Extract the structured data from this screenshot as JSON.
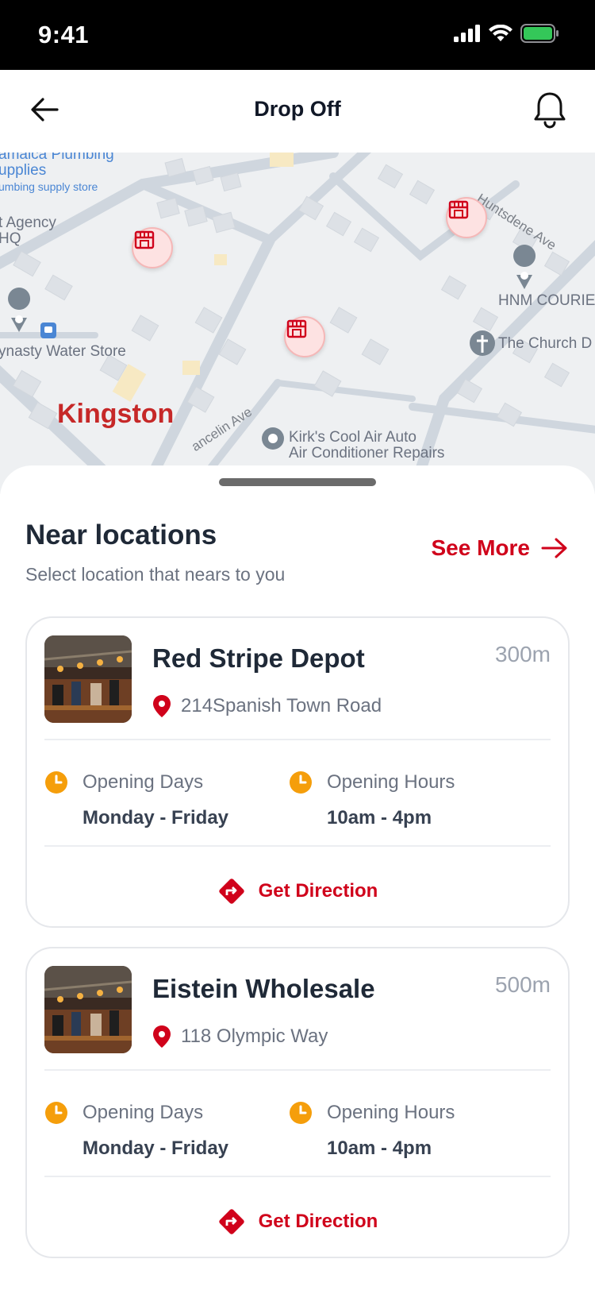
{
  "status_bar": {
    "time": "9:41"
  },
  "header": {
    "title": "Drop Off"
  },
  "map": {
    "labels": {
      "plumbing_1": "amaica Plumbing",
      "plumbing_2": "upplies",
      "plumbing_3": "umbing supply store",
      "agency_1": "t Agency",
      "agency_2": "HQ",
      "water_store": "ynasty Water Store",
      "city": "Kingston",
      "street_1": "Huntsdene Ave",
      "street_2": "ancelin Ave",
      "courier": "HNM COURIE",
      "church": "The Church D",
      "auto": "Kirk's Cool Air Auto",
      "auto_2": "Air Conditioner Repairs"
    }
  },
  "sheet": {
    "title": "Near locations",
    "subtitle": "Select location that nears to you",
    "see_more": "See More"
  },
  "locations": [
    {
      "name": "Red Stripe Depot",
      "distance": "300m",
      "address": "214Spanish Town Road",
      "days_label": "Opening Days",
      "days_value": "Monday - Friday",
      "hours_label": "Opening Hours",
      "hours_value": "10am - 4pm",
      "direction_label": "Get Direction"
    },
    {
      "name": "Eistein Wholesale",
      "distance": "500m",
      "address": "118 Olympic Way",
      "days_label": "Opening Days",
      "days_value": "Monday - Friday",
      "hours_label": "Opening Hours",
      "hours_value": "10am - 4pm",
      "direction_label": "Get Direction"
    }
  ],
  "colors": {
    "accent": "#d0021b",
    "clock": "#f59e0b",
    "battery": "#34c759"
  },
  "icons": [
    "back-arrow-icon",
    "bell-icon",
    "store-pin-icon",
    "location-pin-icon",
    "clock-icon",
    "direction-icon",
    "arrow-right-icon"
  ]
}
